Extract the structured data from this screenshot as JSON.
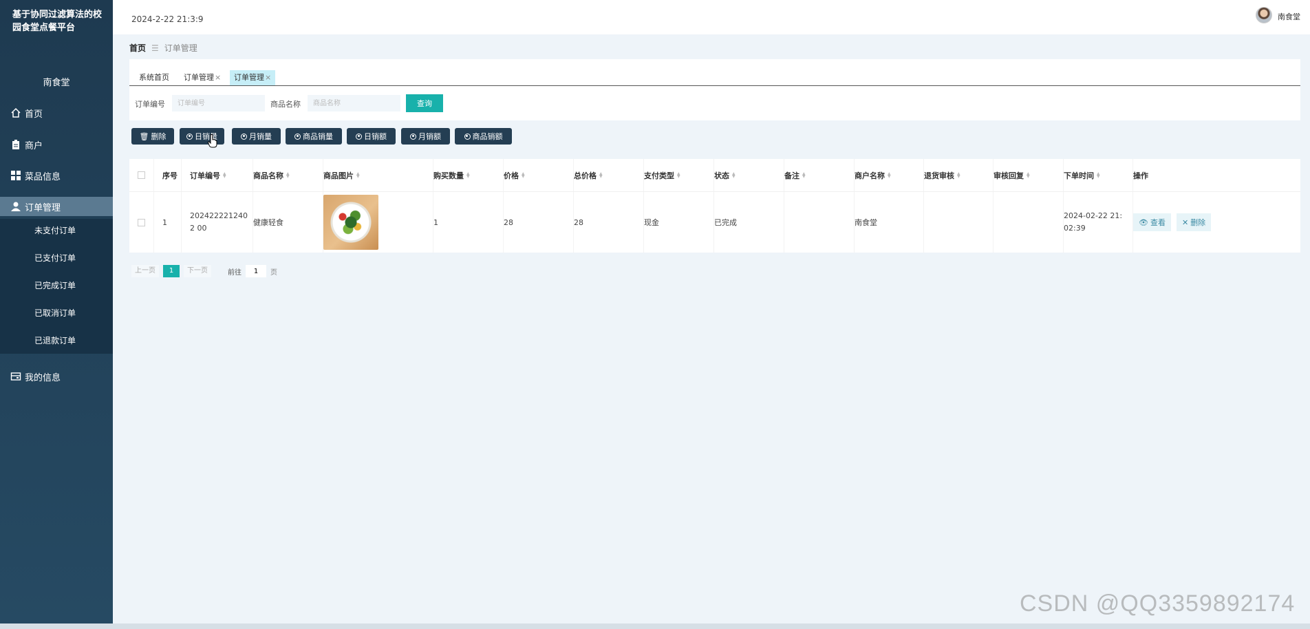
{
  "app": {
    "title": "基于协同过滤算法的校园食堂点餐平台",
    "user_name": "南食堂"
  },
  "sidebar": {
    "items": [
      {
        "label": "首页",
        "icon": "home-icon"
      },
      {
        "label": "商户",
        "icon": "clipboard-icon"
      },
      {
        "label": "菜品信息",
        "icon": "grid-icon"
      },
      {
        "label": "订单管理",
        "icon": "user-icon"
      },
      {
        "label": "我的信息",
        "icon": "card-icon"
      }
    ],
    "sub_items": [
      "未支付订单",
      "已支付订单",
      "已完成订单",
      "已取消订单",
      "已退款订单"
    ]
  },
  "topbar": {
    "datetime": "2024-2-22 21:3:9",
    "user": "南食堂"
  },
  "breadcrumb": {
    "home": "首页",
    "current": "订单管理"
  },
  "tabs": [
    {
      "label": "系统首页"
    },
    {
      "label": "订单管理"
    },
    {
      "label": "订单管理"
    }
  ],
  "search": {
    "order_no_label": "订单编号",
    "order_no_placeholder": "订单编号",
    "product_label": "商品名称",
    "product_placeholder": "商品名称",
    "query_button": "查询"
  },
  "actions": {
    "delete": "删除",
    "daily_sales": "日销量",
    "monthly_sales": "月销量",
    "product_sales": "商品销量",
    "daily_revenue": "日销额",
    "monthly_revenue": "月销额",
    "product_revenue": "商品销额"
  },
  "table": {
    "columns": [
      "序号",
      "订单编号",
      "商品名称",
      "商品图片",
      "购买数量",
      "价格",
      "总价格",
      "支付类型",
      "状态",
      "备注",
      "商户名称",
      "退货审核",
      "审核回复",
      "下单时间",
      "操作"
    ],
    "rows": [
      {
        "index": "1",
        "order_no": "2024222212402 00",
        "product": "健康轻食",
        "quantity": "1",
        "price": "28",
        "total": "28",
        "pay_type": "现金",
        "status": "已完成",
        "remark": "",
        "merchant": "南食堂",
        "return_audit": "",
        "audit_reply": "",
        "order_time": "2024-02-22 21: 02:39",
        "view_label": "查看",
        "delete_label": "删除"
      }
    ]
  },
  "pagination": {
    "prev": "上一页",
    "page": "1",
    "next": "下一页",
    "goto_label": "前往",
    "goto_value": "1",
    "page_suffix": "页"
  },
  "watermark": "CSDN @QQ3359892174",
  "colors": {
    "sidebar_bg": "#1e3a50",
    "accent": "#18b1ab",
    "action_btn": "#243e53"
  }
}
